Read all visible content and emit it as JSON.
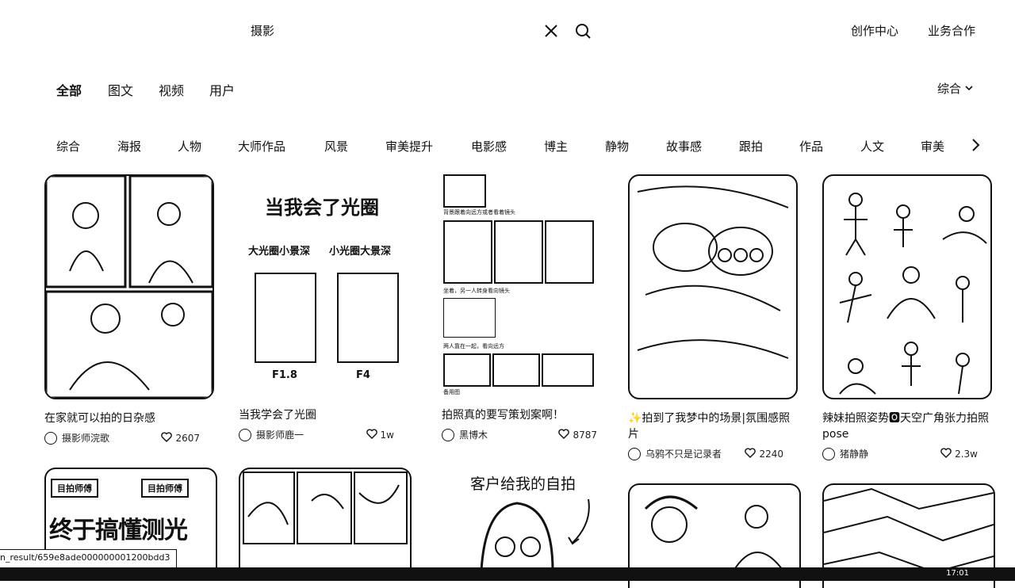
{
  "search": {
    "query": "摄影"
  },
  "top_links": {
    "creator_center": "创作中心",
    "business": "业务合作"
  },
  "type_tabs": [
    "全部",
    "图文",
    "视频",
    "用户"
  ],
  "sort_label": "综合",
  "categories": [
    "综合",
    "海报",
    "人物",
    "大师作品",
    "风景",
    "审美提升",
    "电影感",
    "博主",
    "静物",
    "故事感",
    "跟拍",
    "作品",
    "人文",
    "审美"
  ],
  "cards": [
    {
      "title": "在家就可以拍的日杂感",
      "author": "摄影师浣歌",
      "likes": "2607"
    },
    {
      "title": "当我学会了光圈",
      "author": "摄影师鹿一",
      "likes": "1w",
      "thumb": {
        "heading": "当我会了光圈",
        "left_label": "大光圈小景深",
        "right_label": "小光圈大景深",
        "left_f": "F1.8",
        "right_f": "F4"
      }
    },
    {
      "title": "拍照真的要写策划案啊！",
      "author": "黑博木",
      "likes": "8787",
      "thumb": {
        "cap1": "背景跟着向远方或者看着镜头",
        "cap2": "坐着，另一人转身看向镜头",
        "cap3": "两人靠在一起，看向远方",
        "cap4": "备用图"
      }
    },
    {
      "title": "✨拍到了我梦中的场景|氛围感照片",
      "author": "乌鸦不只是记录者",
      "likes": "2240"
    },
    {
      "title": "辣妹拍照姿势🅾天空广角张力拍照pose",
      "author": "猪静静",
      "likes": "2.3w"
    }
  ],
  "bottom_cards": {
    "poster_text": "终于搞懂测光了!",
    "stamp": "目拍师傅",
    "selfie_caption": "客户给我的自拍"
  },
  "status_url": "n_result/659e8ade000000001200bdd3",
  "clock": "17:01"
}
